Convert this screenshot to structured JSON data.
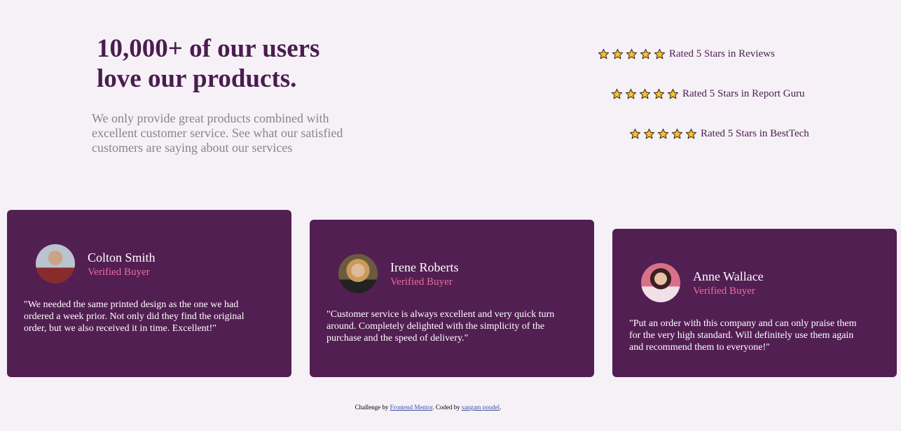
{
  "hero": {
    "title": "10,000+ of our users love our products.",
    "description": "We only provide great products combined with excellent customer service. See what our satisfied customers are saying about our services"
  },
  "ratings": [
    {
      "stars": 5,
      "label": "Rated 5 Stars in Reviews"
    },
    {
      "stars": 5,
      "label": "Rated 5 Stars in Report Guru"
    },
    {
      "stars": 5,
      "label": "Rated 5 Stars in BestTech"
    }
  ],
  "testimonials": [
    {
      "name": "Colton Smith",
      "status": "Verified Buyer",
      "quote": "\"We needed the same printed design as the one we had ordered a week prior. Not only did they find the original order, but we also received it in time. Excellent!\""
    },
    {
      "name": "Irene Roberts",
      "status": "Verified Buyer",
      "quote": "\"Customer service is always excellent and very quick turn around. Completely delighted with the simplicity of the purchase and the speed of delivery.\""
    },
    {
      "name": "Anne Wallace",
      "status": "Verified Buyer",
      "quote": "\"Put an order with this company and can only praise them for the very high standard. Will definitely use them again and recommend them to everyone!\""
    }
  ],
  "footer": {
    "prefix": "Challenge by ",
    "link1": "Frontend Mentor",
    "middle": ". Coded by ",
    "link2": "sangam poudel",
    "suffix": "."
  },
  "colors": {
    "background": "#f6f1f7",
    "primary": "#4a1d4f",
    "card": "#521f52",
    "accent": "#ee6b9f",
    "star": "#fdbf2f"
  }
}
